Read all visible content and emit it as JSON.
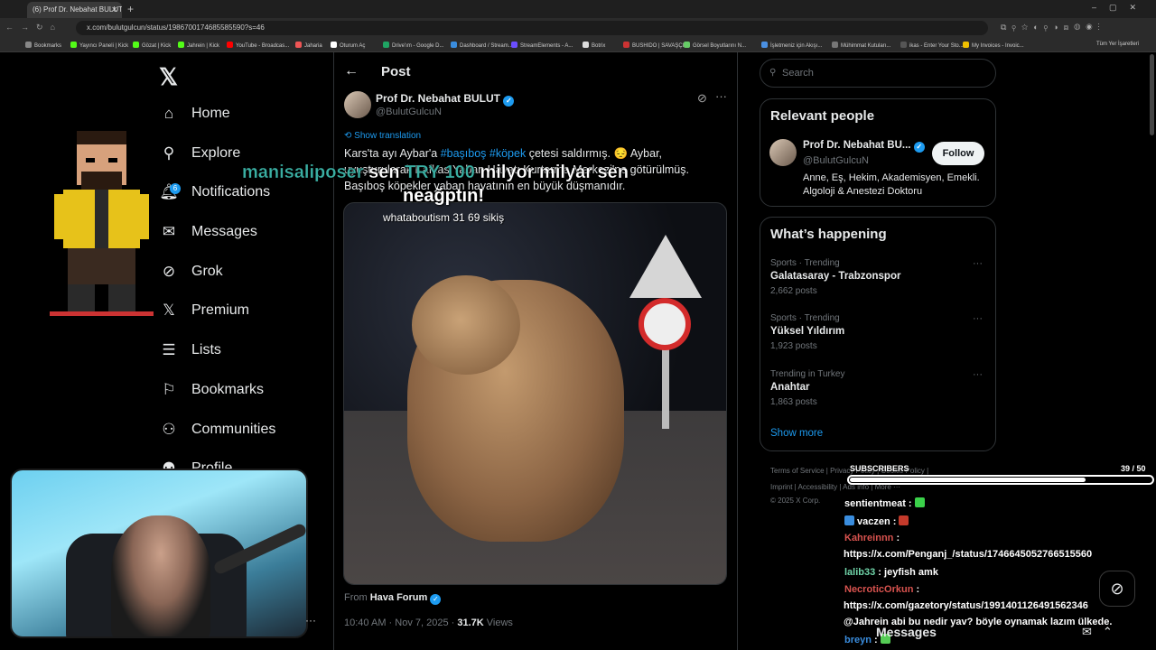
{
  "browser": {
    "tab_title": "(6) Prof Dr. Nebahat BULUT",
    "url": "x.com/bulutgulcun/status/1986700174685585590?s=46",
    "bookmarks": [
      {
        "label": "Bookmarks",
        "color": "#888"
      },
      {
        "label": "Yayıncı Paneli | Kick",
        "color": "#53fc18"
      },
      {
        "label": "Gözat | Kick",
        "color": "#53fc18"
      },
      {
        "label": "Jahrein | Kick",
        "color": "#53fc18"
      },
      {
        "label": "YouTube - Broadcas...",
        "color": "#ff0000"
      },
      {
        "label": "Jaharia",
        "color": "#e55"
      },
      {
        "label": "Oturum Aç",
        "color": "#fff"
      },
      {
        "label": "Drive'ım - Google D...",
        "color": "#1fa463"
      },
      {
        "label": "Dashboard / Stream...",
        "color": "#3a8dde"
      },
      {
        "label": "StreamElements - A...",
        "color": "#6b4eff"
      },
      {
        "label": "Botrix",
        "color": "#ddd"
      },
      {
        "label": "BUSHIDO | SAVAŞÇI...",
        "color": "#c33"
      },
      {
        "label": "Görsel Boyutlarını N...",
        "color": "#6c6"
      },
      {
        "label": "İşletmeniz için Akışı...",
        "color": "#4a90e2"
      },
      {
        "label": "Mühimmat Kutuları...",
        "color": "#777"
      },
      {
        "label": "ikas - Enter Your Sto...",
        "color": "#555"
      },
      {
        "label": "My Invoices - Invoic...",
        "color": "#f0c000"
      }
    ],
    "all_bookmarks": "Tüm Yer İşaretleri"
  },
  "nav": {
    "items": [
      {
        "label": "Home",
        "icon": "home-icon",
        "glyph": "⌂"
      },
      {
        "label": "Explore",
        "icon": "search-icon",
        "glyph": "⚲"
      },
      {
        "label": "Notifications",
        "icon": "bell-icon",
        "glyph": "🔔︎"
      },
      {
        "label": "Messages",
        "icon": "mail-icon",
        "glyph": "✉"
      },
      {
        "label": "Grok",
        "icon": "grok-icon",
        "glyph": "⊘"
      },
      {
        "label": "Premium",
        "icon": "x-icon",
        "glyph": "𝕏"
      },
      {
        "label": "Lists",
        "icon": "list-icon",
        "glyph": "☰"
      },
      {
        "label": "Bookmarks",
        "icon": "bookmark-icon",
        "glyph": "⚐"
      },
      {
        "label": "Communities",
        "icon": "communities-icon",
        "glyph": "⚇"
      },
      {
        "label": "Profile",
        "icon": "profile-icon",
        "glyph": "⚉"
      }
    ],
    "notif_badge": "6"
  },
  "post": {
    "header": "Post",
    "author": "Prof Dr. Nebahat BULUT",
    "handle": "@BulutGulcuN",
    "show_translation": "Show translation",
    "text_1": "Kars'ta ayı Aybar'a ",
    "hash_1": "#başıboş",
    "text_2": " ",
    "hash_2": "#köpek",
    "text_3": " çetesi saldırmış. 😔 Aybar, uyuşturularak Kafkas Yaban Hayatı Kurtarma Merkezi'ne götürülmüş. Başıboş köpekler yaban hayatının en büyük düşmanıdır.",
    "from_label": "From",
    "from_name": "Hava Forum",
    "time": "10:40 AM · Nov 7, 2025 · ",
    "views_count": "31.7K",
    "views_label": " Views"
  },
  "right": {
    "search_placeholder": "Search",
    "relevant": {
      "title": "Relevant people",
      "name": "Prof Dr. Nebahat BU...",
      "handle": "@BulutGulcuN",
      "follow": "Follow",
      "bio": "Anne, Eş, Hekim, Akademisyen, Emekli. Algoloji & Anestezi Doktoru"
    },
    "happening": {
      "title": "What’s happening",
      "trends": [
        {
          "cat": "Sports · Trending",
          "name": "Galatasaray - Trabzonspor",
          "count": "2,662 posts"
        },
        {
          "cat": "Sports · Trending",
          "name": "Yüksel Yıldırım",
          "count": "1,923 posts"
        },
        {
          "cat": "Trending in Turkey",
          "name": "Anahtar",
          "count": "1,863 posts"
        }
      ],
      "show_more": "Show more"
    },
    "footer_1": "Terms of Service  |  Privacy Policy  |  Cookie Policy  |",
    "footer_2": "Imprint  |  Accessibility  |  Ads info  |  More ···",
    "footer_3": "© 2025 X Corp."
  },
  "overlay": {
    "user": "manisaliposer",
    "w1": " sen ",
    "amount": "TRY 100",
    "w2": " milyor milyar sen",
    "line2": "neağptın!",
    "line3": "whataboutism 31 69 sikiş"
  },
  "subs": {
    "label": "SUBSCRIBERS",
    "count": "39  / 50",
    "progress": 0.78
  },
  "chat": [
    {
      "user": "sentientmeat",
      "color": "#ffffff",
      "text": "",
      "emote": "#3bd14a"
    },
    {
      "user": "vaczen",
      "color": "#ffffff",
      "text": "",
      "emote": "#c43a2b",
      "prefix": "#3a8dde"
    },
    {
      "user": "Kahreinnn",
      "color": "#d9534f",
      "text": ""
    },
    {
      "user": "",
      "color": "#ffffff",
      "text": "https://x.com/Penganj_/status/1746645052766515560"
    },
    {
      "user": "lalib33",
      "color": "#6fd3a8",
      "text": "jeyfish amk"
    },
    {
      "user": "NecroticOrkun",
      "color": "#d9534f",
      "text": ""
    },
    {
      "user": "",
      "color": "#ffffff",
      "text": "https://x.com/gazetory/status/1991401126491562346"
    },
    {
      "user": "",
      "color": "#ffffff",
      "text": "@Jahrein abi bu nedir yav? böyle oynamak lazım ülkede."
    },
    {
      "user": "breyn",
      "color": "#3a8dde",
      "text": "",
      "emote": "#5c5"
    }
  ],
  "messages_bar": "Messages"
}
